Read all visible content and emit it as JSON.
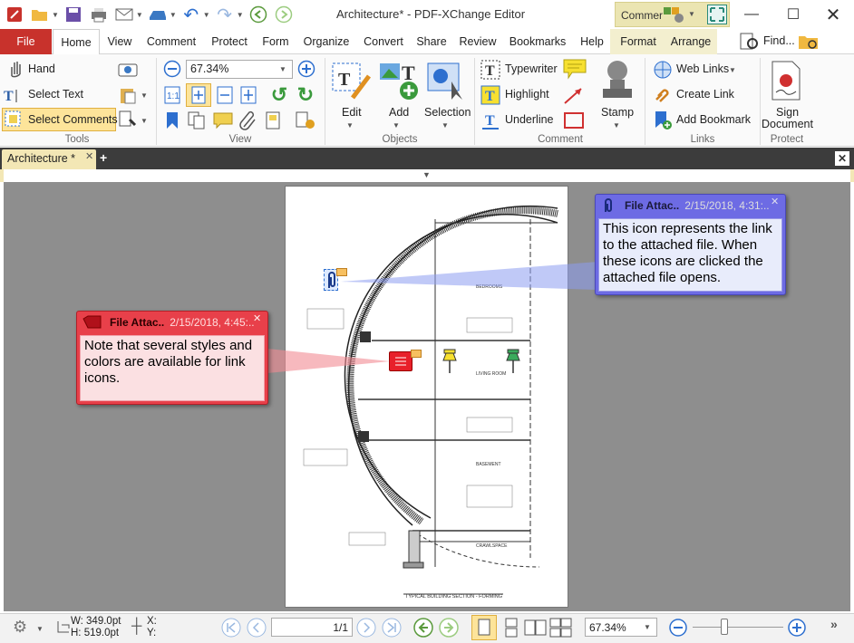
{
  "window": {
    "title": "Architecture* - PDF-XChange Editor",
    "context_tab_group": "Commer"
  },
  "menu_tabs": [
    "File",
    "Home",
    "View",
    "Comment",
    "Protect",
    "Form",
    "Organize",
    "Convert",
    "Share",
    "Review",
    "Bookmarks",
    "Help",
    "Format",
    "Arrange"
  ],
  "find_label": "Find...",
  "ribbon": {
    "tools": {
      "hand": "Hand",
      "select_text": "Select Text",
      "select_comments": "Select Comments",
      "group": "Tools"
    },
    "view": {
      "zoom": "67.34%",
      "group": "View"
    },
    "objects": {
      "edit": "Edit",
      "add": "Add",
      "selection": "Selection",
      "group": "Objects"
    },
    "comment": {
      "typewriter": "Typewriter",
      "highlight": "Highlight",
      "underline": "Underline",
      "stamp": "Stamp",
      "group": "Comment"
    },
    "links": {
      "web_links": "Web Links",
      "create_link": "Create Link",
      "add_bookmark": "Add Bookmark",
      "group": "Links"
    },
    "protect": {
      "sign_line1": "Sign",
      "sign_line2": "Document",
      "group": "Protect"
    }
  },
  "document_tab": "Architecture *",
  "popups": {
    "blue": {
      "title": "File Attac..",
      "date": "2/15/2018, 4:31:..",
      "body": "This icon represents the link to the attached file. When these icons are clicked the attached file opens.",
      "color": "#6d6be4"
    },
    "red": {
      "title": "File Attac..",
      "date": "2/15/2018, 4:45:..",
      "body": "Note that several styles and colors are available for link icons.",
      "color": "#e8404a"
    }
  },
  "drawing": {
    "title": "TYPICAL BUILDING SECTION - FORMING",
    "rooms": [
      "BEDROOMS",
      "LIVING ROOM",
      "BASEMENT",
      "CRAWLSPACE"
    ]
  },
  "statusbar": {
    "width": "W: 349.0pt",
    "height": "H: 519.0pt",
    "x": "X:",
    "y": "Y:",
    "page": "1/1",
    "zoom": "67.34%"
  },
  "colors": {
    "file_tab": "#c8322c",
    "context_band": "#ebe5b2",
    "doc_tab": "#f3e7b5",
    "viewer_bg": "#8e8e8e"
  }
}
